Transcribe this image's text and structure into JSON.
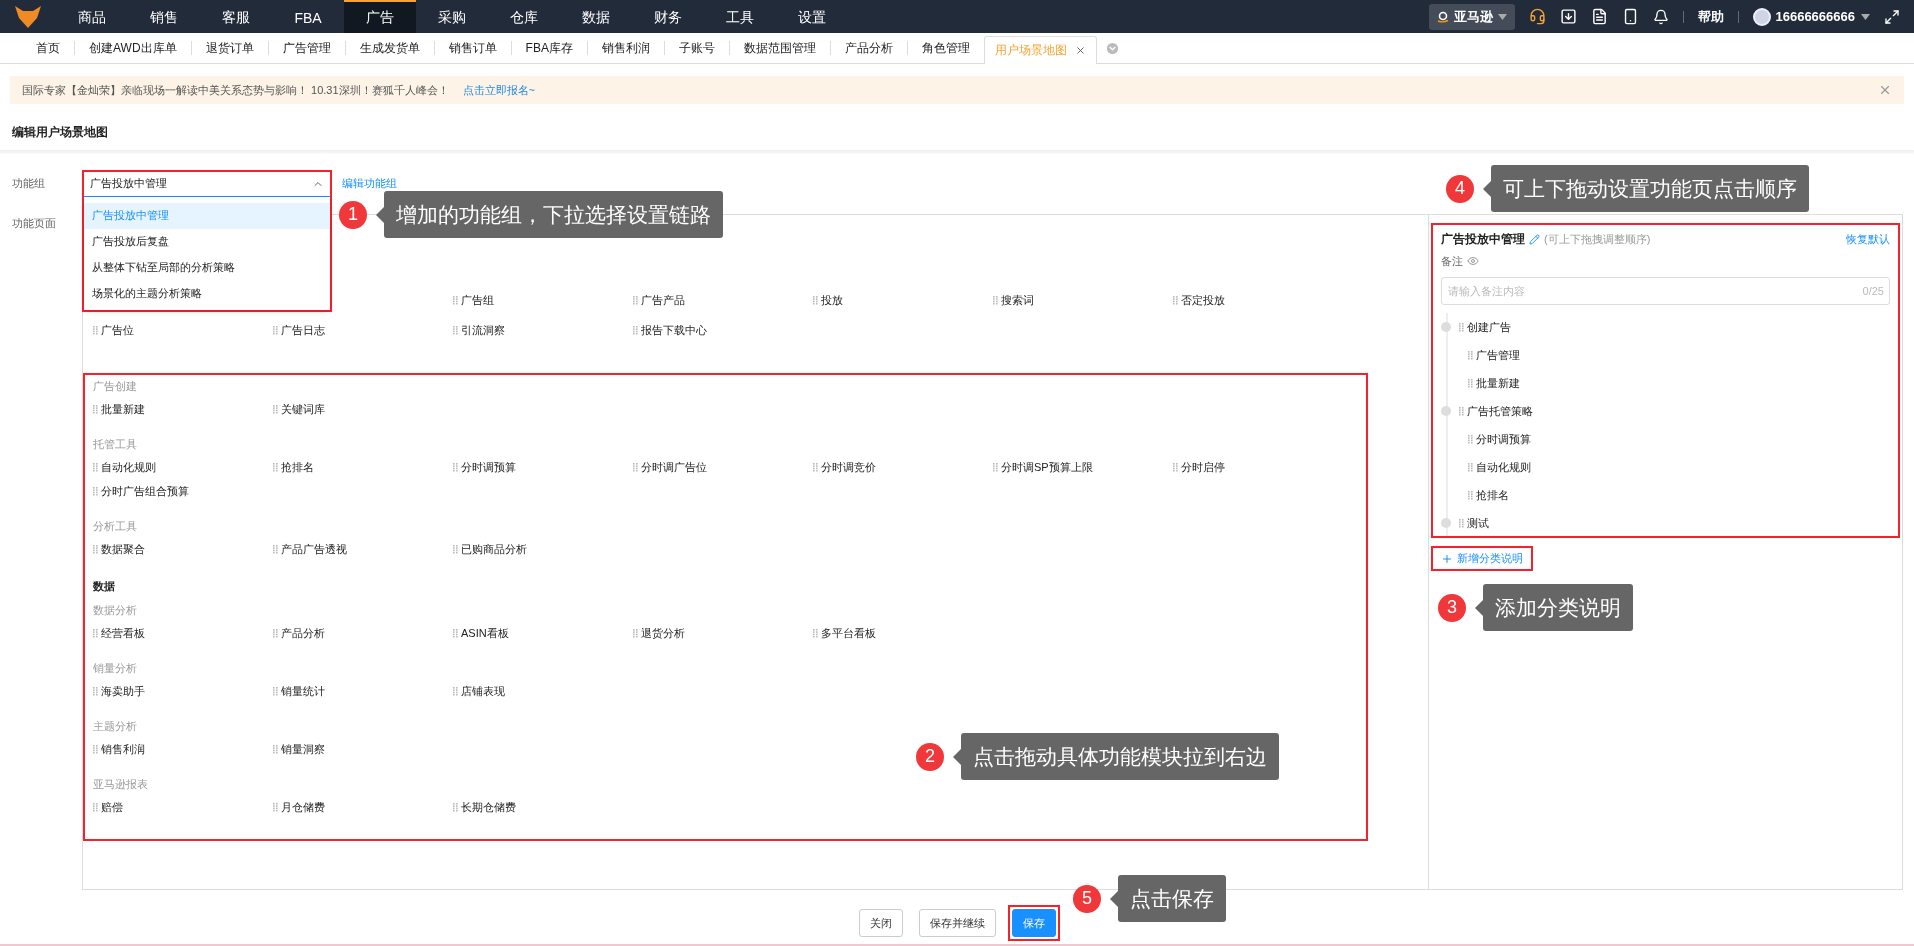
{
  "top_nav": {
    "items": [
      {
        "label": "商品",
        "selected": false
      },
      {
        "label": "销售",
        "selected": false
      },
      {
        "label": "客服",
        "selected": false
      },
      {
        "label": "FBA",
        "selected": false
      },
      {
        "label": "广告",
        "selected": true
      },
      {
        "label": "采购",
        "selected": false
      },
      {
        "label": "仓库",
        "selected": false
      },
      {
        "label": "数据",
        "selected": false
      },
      {
        "label": "财务",
        "selected": false
      },
      {
        "label": "工具",
        "selected": false
      },
      {
        "label": "设置",
        "selected": false
      }
    ],
    "store": "亚马逊",
    "help": "帮助",
    "user": "16666666666"
  },
  "tabs": [
    {
      "label": "首页",
      "selected": false
    },
    {
      "label": "创建AWD出库单",
      "selected": false
    },
    {
      "label": "退货订单",
      "selected": false
    },
    {
      "label": "广告管理",
      "selected": false
    },
    {
      "label": "生成发货单",
      "selected": false
    },
    {
      "label": "销售订单",
      "selected": false
    },
    {
      "label": "FBA库存",
      "selected": false
    },
    {
      "label": "销售利润",
      "selected": false
    },
    {
      "label": "子账号",
      "selected": false
    },
    {
      "label": "数据范围管理",
      "selected": false
    },
    {
      "label": "产品分析",
      "selected": false
    },
    {
      "label": "角色管理",
      "selected": false
    },
    {
      "label": "用户场景地图",
      "selected": true
    }
  ],
  "notice": {
    "text": "国际专家【金灿荣】亲临现场一解读中美关系态势与影响！ 10.31深圳！赛狐千人峰会！",
    "link": "点击立即报名~"
  },
  "page_title": "编辑用户场景地图",
  "function_group": {
    "label": "功能组",
    "value": "广告投放中管理",
    "expanded": true,
    "highlighted": true,
    "edit_link": "编辑功能组",
    "options": [
      {
        "label": "广告投放中管理",
        "selected": true
      },
      {
        "label": "广告投放后复盘",
        "selected": false
      },
      {
        "label": "从整体下钻至局部的分析策略",
        "selected": false
      },
      {
        "label": "场景化的主题分析策略",
        "selected": false
      }
    ]
  },
  "function_pages": {
    "label": "功能页面",
    "sections": [
      {
        "highlighted": false,
        "blocks": [
          {
            "kind": "group",
            "items": [
              "广告组",
              "广告产品",
              "投放",
              "搜索词",
              "否定投放",
              "广告位",
              "广告日志",
              "引流洞察",
              "报告下载中心"
            ]
          }
        ]
      },
      {
        "highlighted": true,
        "blocks": [
          {
            "kind": "group",
            "title": "广告创建",
            "items": [
              "批量新建",
              "关键词库"
            ]
          },
          {
            "kind": "group",
            "title": "托管工具",
            "items": [
              "自动化规则",
              "抢排名",
              "分时调预算",
              "分时调广告位",
              "分时调竞价",
              "分时调SP预算上限",
              "分时启停",
              "分时广告组合预算"
            ]
          },
          {
            "kind": "group",
            "title": "分析工具",
            "items": [
              "数据聚合",
              "产品广告透视",
              "已购商品分析"
            ]
          },
          {
            "kind": "heading",
            "title": "数据"
          },
          {
            "kind": "group",
            "title": "数据分析",
            "items": [
              "经营看板",
              "产品分析",
              "ASIN看板",
              "退货分析",
              "多平台看板"
            ]
          },
          {
            "kind": "group",
            "title": "销量分析",
            "items": [
              "海卖助手",
              "销量统计",
              "店铺表现"
            ]
          },
          {
            "kind": "group",
            "title": "主题分析",
            "items": [
              "销售利润",
              "销量洞察"
            ]
          },
          {
            "kind": "group",
            "title": "亚马逊报表",
            "items": [
              "赔偿",
              "月仓储费",
              "长期仓储费"
            ]
          }
        ]
      }
    ]
  },
  "order_panel": {
    "title": "广告投放中管理",
    "hint": "(可上下拖拽调整顺序)",
    "reset_link": "恢复默认",
    "note_label": "备注",
    "note_placeholder": "请输入备注内容",
    "note_counter": "0/25",
    "highlighted": true,
    "tree": [
      {
        "label": "创建广告",
        "children": [
          {
            "label": "广告管理"
          },
          {
            "label": "批量新建"
          }
        ]
      },
      {
        "label": "广告托管策略",
        "children": [
          {
            "label": "分时调预算"
          },
          {
            "label": "自动化规则"
          },
          {
            "label": "抢排名"
          }
        ]
      },
      {
        "label": "测试"
      }
    ],
    "add_link": {
      "label": "新增分类说明",
      "highlighted": true
    }
  },
  "buttons": [
    {
      "label": "关闭",
      "kind": "default",
      "highlighted": false
    },
    {
      "label": "保存并继续",
      "kind": "default",
      "highlighted": false
    },
    {
      "label": "保存",
      "kind": "primary",
      "highlighted": true
    }
  ],
  "callouts": [
    {
      "number": "4",
      "text": "可上下拖动设置功能页点击顺序"
    },
    {
      "number": "1",
      "text": "增加的功能组，下拉选择设置链路"
    },
    {
      "number": "3",
      "text": "添加分类说明"
    },
    {
      "number": "2",
      "text": "点击拖动具体功能模块拉到右边"
    },
    {
      "number": "5",
      "text": "点击保存"
    }
  ]
}
